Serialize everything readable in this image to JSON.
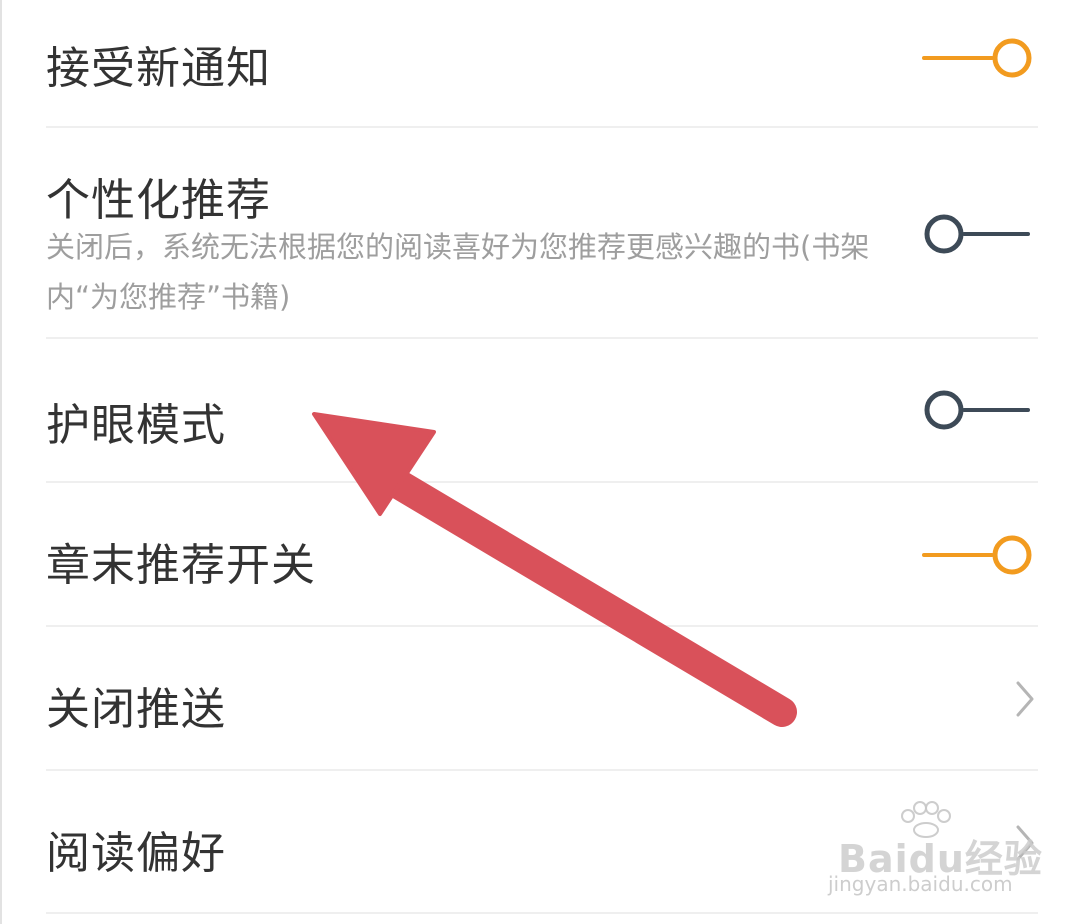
{
  "settings": {
    "items": [
      {
        "title": "接受新通知",
        "control": "toggle",
        "on": true
      },
      {
        "title": "个性化推荐",
        "description": "关闭后，系统无法根据您的阅读喜好为您推荐更感兴趣的书(书架内“为您推荐”书籍)",
        "control": "toggle",
        "on": false
      },
      {
        "title": "护眼模式",
        "control": "toggle",
        "on": false
      },
      {
        "title": "章末推荐开关",
        "control": "toggle",
        "on": true
      },
      {
        "title": "关闭推送",
        "control": "chevron"
      },
      {
        "title": "阅读偏好",
        "control": "chevron"
      }
    ]
  },
  "annotation": {
    "arrow_color": "#d9515a",
    "points_to": "护眼模式"
  },
  "watermark": {
    "brand": "Baidu经验",
    "url": "jingyan.baidu.com"
  },
  "colors": {
    "toggle_on": "#f29b1f",
    "toggle_off": "#3d4a57",
    "title_text": "#333333",
    "desc_text": "#9e9e9e",
    "divider": "#efefef",
    "chevron": "#b5b5b5"
  }
}
